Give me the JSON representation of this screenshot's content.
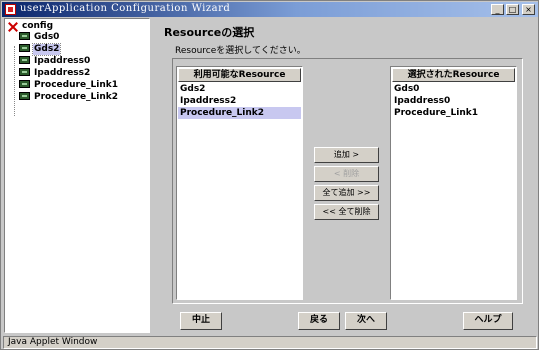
{
  "window": {
    "title": "userApplication Configuration Wizard",
    "minimize": "_",
    "maximize": "□",
    "close": "×"
  },
  "tree": {
    "root": "config",
    "items": [
      {
        "label": "Gds0",
        "selected": false
      },
      {
        "label": "Gds2",
        "selected": true
      },
      {
        "label": "Ipaddress0",
        "selected": false
      },
      {
        "label": "Ipaddress2",
        "selected": false
      },
      {
        "label": "Procedure_Link1",
        "selected": false
      },
      {
        "label": "Procedure_Link2",
        "selected": false
      }
    ]
  },
  "main": {
    "heading": "Resourceの選択",
    "instruction": "Resourceを選択してください。",
    "available": {
      "header": "利用可能なResource",
      "items": [
        "Gds2",
        "Ipaddress2",
        "Procedure_Link2"
      ],
      "selected_item": "Procedure_Link2"
    },
    "selected": {
      "header": "選択されたResource",
      "items": [
        "Gds0",
        "Ipaddress0",
        "Procedure_Link1"
      ]
    },
    "buttons": {
      "add": "追加 >",
      "remove": "< 削除",
      "add_all": "全て追加 >>",
      "remove_all": "<< 全て削除"
    }
  },
  "footer": {
    "cancel": "中止",
    "back": "戻る",
    "next": "次へ",
    "help": "ヘルプ"
  },
  "status": {
    "text": "Java Applet Window"
  }
}
